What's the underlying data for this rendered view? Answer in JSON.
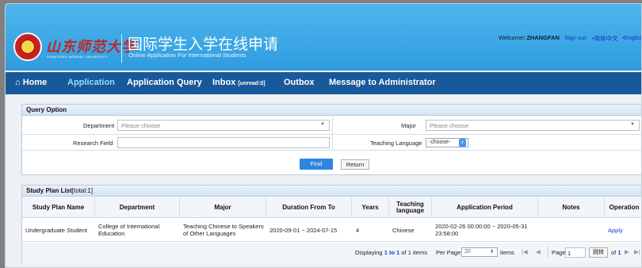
{
  "header": {
    "logo_text_cn": "山东师范大学",
    "logo_text_en": "SHANDONG NORMAL UNIVERSITY",
    "title_cn": "国际学生入学在线申请",
    "title_en": "Online Application For International Students",
    "welcome_prefix": "Welcome!",
    "username": "ZHANGFAN",
    "sign_out": "Sign out",
    "lang_cn": "•简体中文",
    "lang_en": "•English"
  },
  "nav": {
    "home": "Home",
    "application": "Application",
    "application_query": "Application Query",
    "inbox": "Inbox",
    "inbox_badge": "[unread:0]",
    "outbox": "Outbox",
    "message": "Message to Administrator"
  },
  "query": {
    "title": "Query Option",
    "department_label": "Department",
    "department_placeholder": "Please choose",
    "major_label": "Major",
    "major_placeholder": "Please choose",
    "research_label": "Research Field",
    "research_value": "",
    "teaching_language_label": "Teaching Language",
    "teaching_language_value": "-choose-",
    "find": "Find",
    "return": "Return"
  },
  "plan": {
    "title": "Study Plan List",
    "total": "[total:1]",
    "columns": [
      "Study Plan Name",
      "Department",
      "Major",
      "Duration From To",
      "Years",
      "Teaching language",
      "Application Period",
      "Notes",
      "Operation"
    ],
    "rows": [
      {
        "name": "Undergraduate Student",
        "department": "College of International Education",
        "major": "Teaching Chinese to Speakers of Other Languages",
        "duration": "2020-09-01 ~ 2024-07-15",
        "years": "4",
        "language": "Chinese",
        "period": "2020-02-26 00:00:00 ~ 2020-05-31 23:58:00",
        "notes": "",
        "operation": "Apply"
      }
    ]
  },
  "pager": {
    "displaying": "Displaying",
    "range_from": "1",
    "to": "to",
    "range_to": "1",
    "of": "of",
    "total": "1",
    "items": "items",
    "per_page_label": "Per Page",
    "per_page_value": "20",
    "items_label": "items",
    "page_label": "Page",
    "page_value": "1",
    "goto": "跳转",
    "of_label": "of",
    "page_total": "1"
  },
  "colors": {
    "topbar": "#3aa7e6",
    "navbar": "#17599a",
    "link": "#1b3fd0",
    "button": "#2f86e0"
  }
}
